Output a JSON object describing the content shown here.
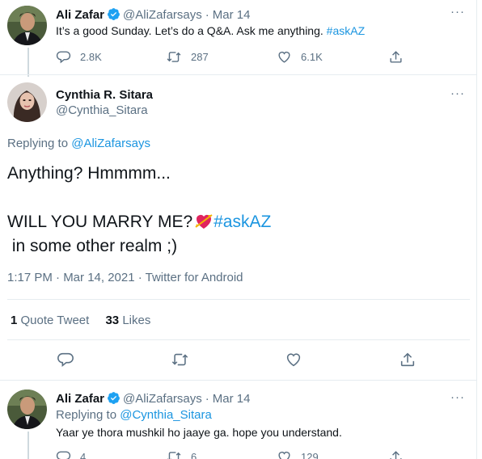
{
  "tweet_top": {
    "author_name": "Ali Zafar",
    "handle": "@AliZafarsays",
    "separator": "·",
    "date": "Mar 14",
    "text_main": "It’s a good Sunday. Let’s do a Q&A. Ask me anything.",
    "hashtag": "#askAZ",
    "replies": "2.8K",
    "retweets": "287",
    "likes": "6.1K",
    "more": "···"
  },
  "tweet_main": {
    "author_name": "Cynthia R. Sitara",
    "handle": "@Cynthia_Sitara",
    "more": "···",
    "replying_prefix": "Replying to",
    "replying_handle": "@AliZafarsays",
    "line1": "Anything? Hmmmm...",
    "line2": "WILL YOU MARRY ME?",
    "hashtag": "#askAZ",
    "line3": " in some other realm ;)",
    "meta": "1:17 PM · Mar 14, 2021 · Twitter for Android",
    "quote_count": "1",
    "quote_label": "Quote Tweet",
    "likes_count": "33",
    "likes_label": "Likes"
  },
  "tweet_reply": {
    "author_name": "Ali Zafar",
    "handle": "@AliZafarsays",
    "separator": "·",
    "date": "Mar 14",
    "replying_prefix": "Replying to",
    "replying_handle": "@Cynthia_Sitara",
    "text": "Yaar ye thora mushkil ho jaaye ga. hope you understand.",
    "replies": "4",
    "retweets": "6",
    "likes": "129",
    "more": "···"
  },
  "colors": {
    "link_blue": "#1b95e0",
    "muted_grey": "#5b7083",
    "verified_blue": "#1da1f2",
    "heart_emoji": "#e0245e"
  },
  "icons": [
    "reply-icon",
    "retweet-icon",
    "like-icon",
    "share-icon",
    "verified-badge-icon",
    "more-icon",
    "heart-arrow-emoji"
  ]
}
